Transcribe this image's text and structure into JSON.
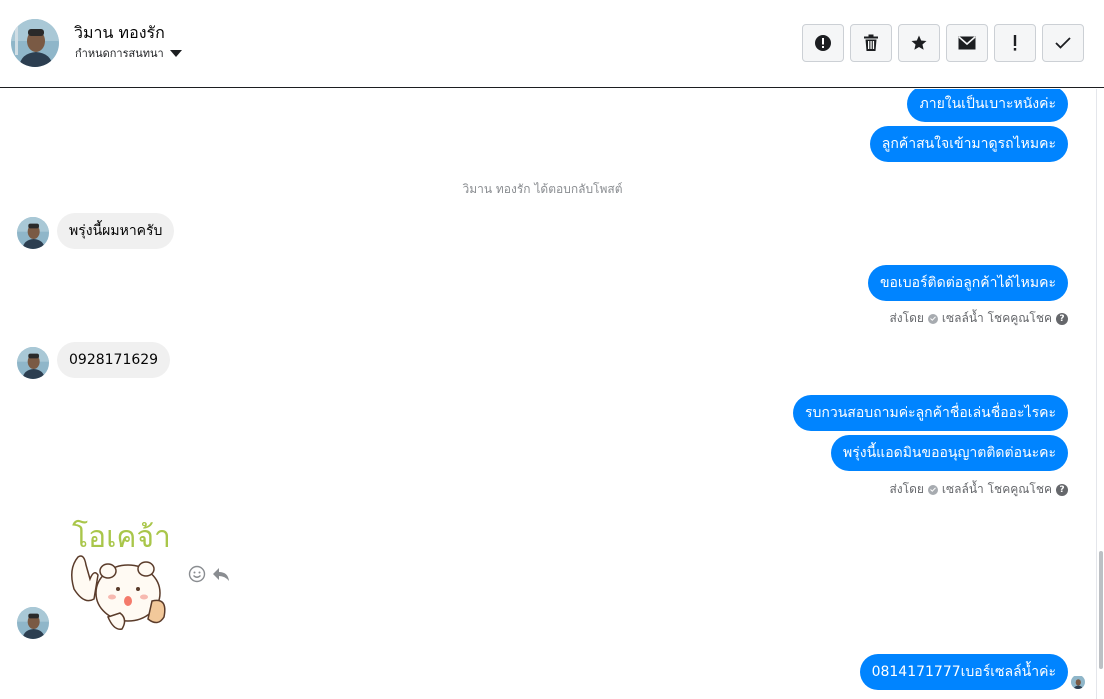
{
  "header": {
    "name": "วิมาน ทองรัก",
    "subtitle": "กำหนดการสนทนา",
    "actions": [
      {
        "icon": "alert-circle-icon"
      },
      {
        "icon": "trash-icon"
      },
      {
        "icon": "star-icon"
      },
      {
        "icon": "envelope-icon"
      },
      {
        "icon": "exclamation-icon"
      },
      {
        "icon": "checkmark-icon"
      }
    ]
  },
  "messages": {
    "out1": "ภายในเป็นเบาะหนังค่ะ",
    "out2": "ลูกค้าสนใจเข้ามาดูรถไหมคะ",
    "system_note": "วิมาน ทองรัก ได้ตอบกลับโพสต์",
    "in1": "พรุ่งนี้ผมหาครับ",
    "out3": "ขอเบอร์ติดต่อลูกค้าได้ไหมคะ",
    "sent_by_1": {
      "prefix": "ส่งโดย",
      "name": "เซลล์น้ำ โชคคูณโชค",
      "help": "?"
    },
    "in2": "0928171629",
    "out4": "รบกวนสอบถามค่ะลูกค้าชื่อเล่นชื่ออะไรคะ",
    "out5": "พรุ่งนี้แอดมินขออนุญาตติดต่อนะคะ",
    "sent_by_2": {
      "prefix": "ส่งโดย",
      "name": "เซลล์น้ำ โชคคูณโชค",
      "help": "?"
    },
    "sticker_text": "โอเคจ้า",
    "out6": "0814171777เบอร์เซลล์น้ำค่ะ"
  },
  "colors": {
    "outgoing_bubble": "#0084ff",
    "incoming_bubble": "#f0f0f0",
    "system_text": "#8a8d91",
    "sticker_text": "#a9c64a"
  }
}
